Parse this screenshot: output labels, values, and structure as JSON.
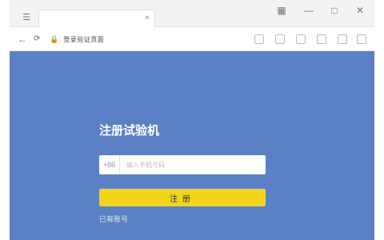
{
  "browser": {
    "tab_title": "",
    "tab_close": "×",
    "window_controls": {
      "minimize": "—",
      "maximize": "□",
      "close": "✕"
    },
    "nav": {
      "back": "←",
      "forward": "→",
      "reload": "⟳"
    },
    "address": {
      "lock": "🔒",
      "url": "登录验证页面"
    }
  },
  "page": {
    "heading": "注册试验机",
    "phone_prefix": "+86",
    "phone_placeholder": "输入手机号码",
    "submit_label": "注册",
    "link_text": "已有账号"
  },
  "colors": {
    "page_background": "#5b80c5",
    "button": "#f2d51b",
    "heading_text": "#ffffff"
  }
}
